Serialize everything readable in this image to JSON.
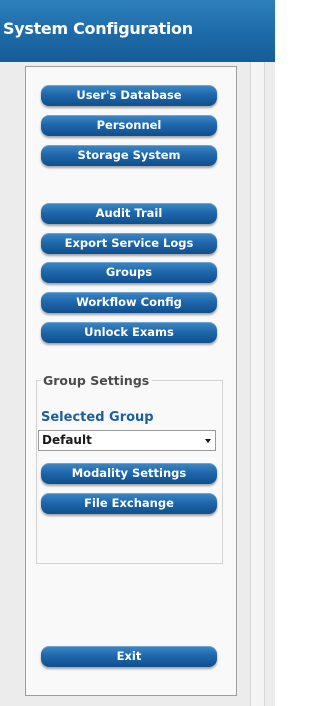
{
  "header": {
    "title": "System Configuration"
  },
  "menu": {
    "users_database": "User's Database",
    "personnel": "Personnel",
    "storage_system": "Storage System",
    "audit_trail": "Audit Trail",
    "export_service_logs": "Export Service Logs",
    "groups": "Groups",
    "workflow_config": "Workflow Config",
    "unlock_exams": "Unlock Exams"
  },
  "group_settings": {
    "title": "Group Settings",
    "selected_group_label": "Selected Group",
    "selected_group_value": "Default",
    "modality_settings": "Modality Settings",
    "file_exchange": "File Exchange"
  },
  "footer": {
    "exit": "Exit"
  },
  "colors": {
    "header_blue": "#1d6aa8",
    "button_blue": "#1f68ac",
    "label_blue": "#1c5f9d",
    "background_gray": "#ececec"
  },
  "icons": {
    "dropdown": "chevron-down-icon"
  }
}
